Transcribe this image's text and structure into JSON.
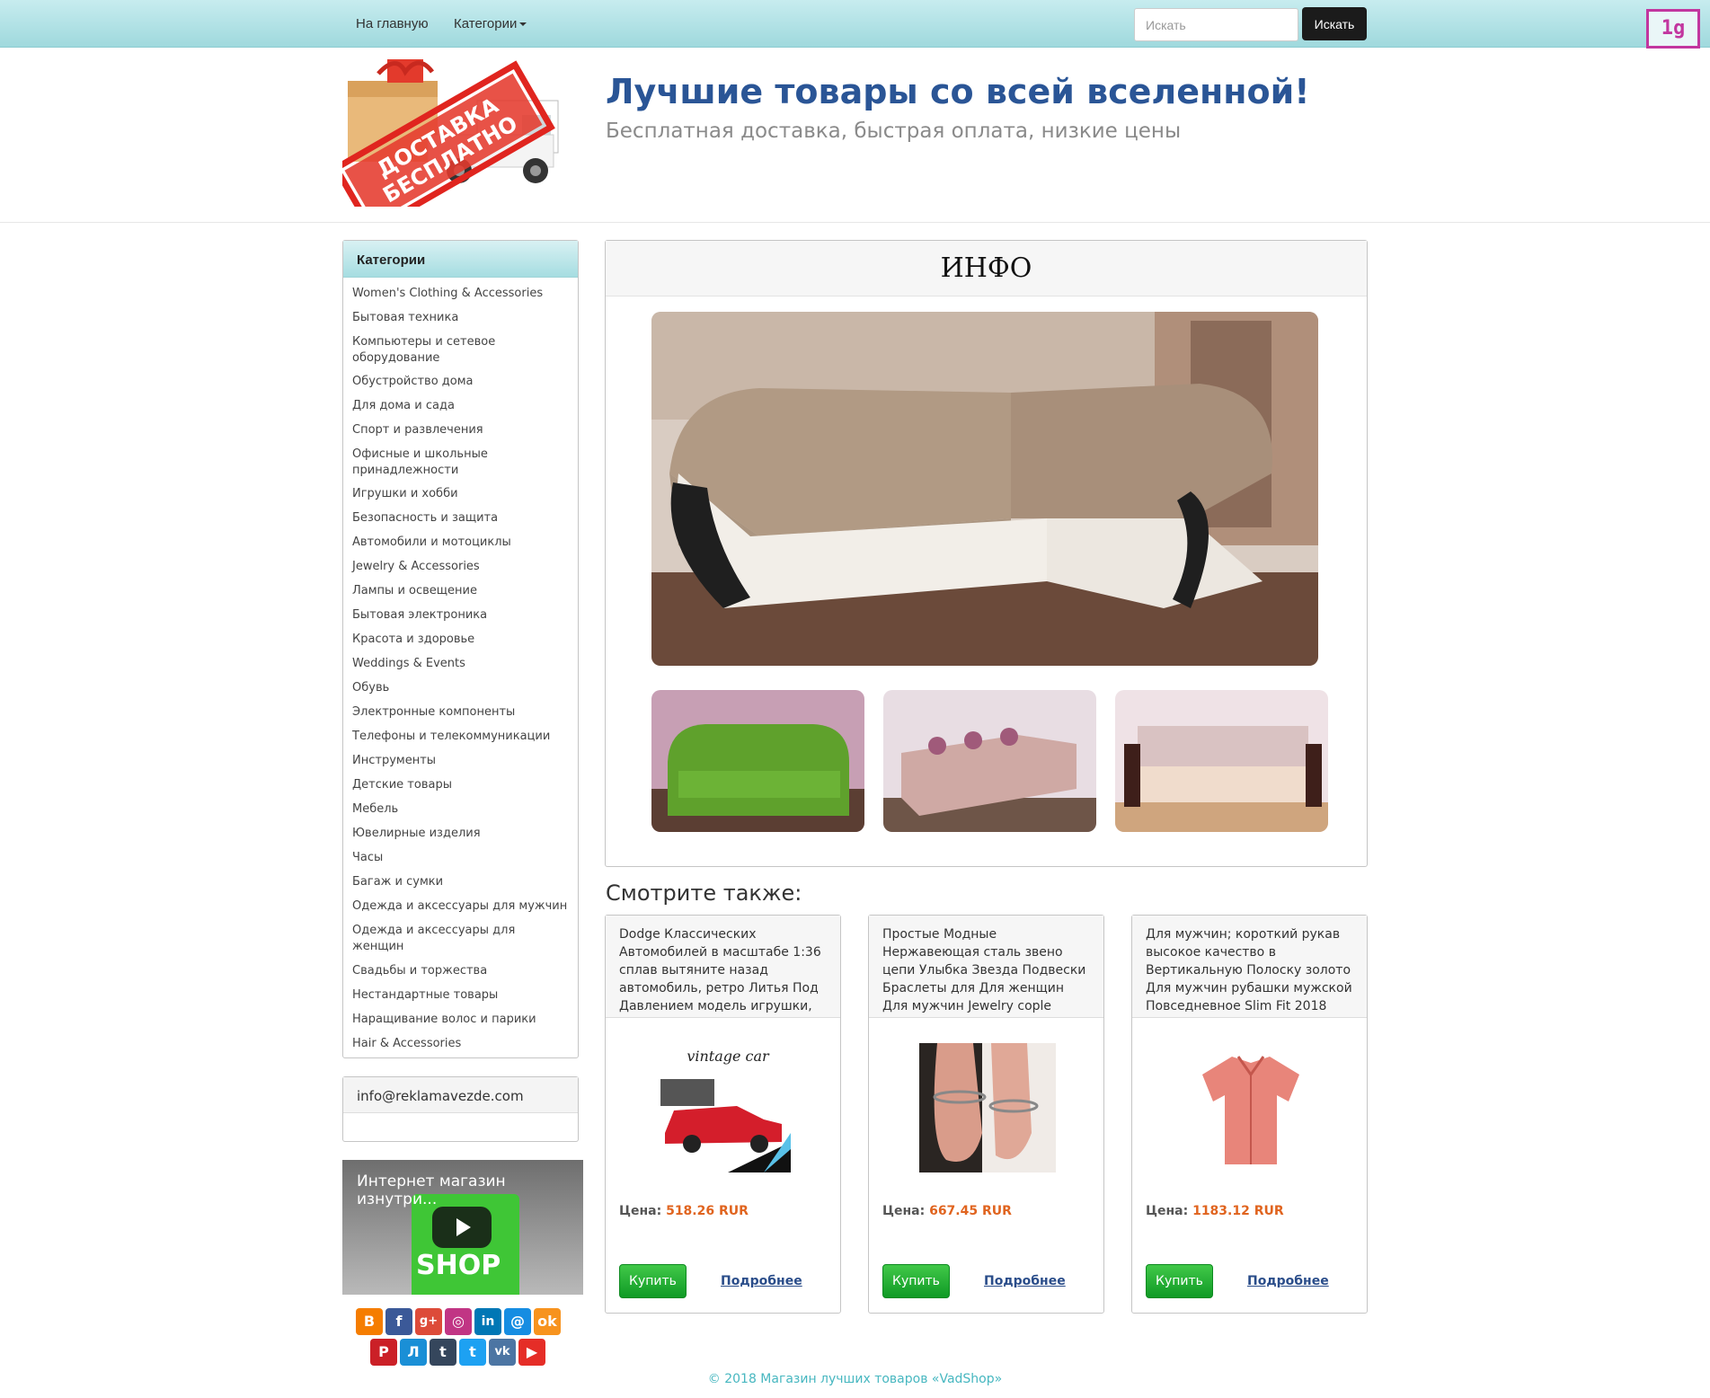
{
  "nav": {
    "home": "На главную",
    "categories": "Категории",
    "search_placeholder": "Искать",
    "search_button": "Искать",
    "badge": "1g"
  },
  "header": {
    "logo_line1": "ДОСТАВКА",
    "logo_line2": "БЕСПЛАТНО",
    "title": "Лучшие товары со всей вселенной!",
    "subtitle": "Бесплатная доставка, быстрая оплата, низкие цены"
  },
  "sidebar": {
    "categories_title": "Категории",
    "items": [
      "Women's Clothing & Accessories",
      "Бытовая техника",
      "Компьютеры и сетевое оборудование",
      "Обустройство дома",
      "Для дома и сада",
      "Спорт и развлечения",
      "Офисные и школьные принадлежности",
      "Игрушки и хобби",
      "Безопасность и защита",
      "Автомобили и мотоциклы",
      "Jewelry & Accessories",
      "Лампы и освещение",
      "Бытовая электроника",
      "Красота и здоровье",
      "Weddings & Events",
      "Обувь",
      "Электронные компоненты",
      "Телефоны и телекоммуникации",
      "Инструменты",
      "Детские товары",
      "Мебель",
      "Ювелирные изделия",
      "Часы",
      "Багаж и сумки",
      "Одежда и аксессуары для мужчин",
      "Одежда и аксессуары для женщин",
      "Свадьбы и торжества",
      "Нестандартные товары",
      "Наращивание волос и парики",
      "Hair & Accessories"
    ],
    "email": "info@reklamavezde.com",
    "video_title": "Интернет магазин изнутри...",
    "video_brand": "SHOP",
    "socials": [
      "blogger-icon",
      "facebook-icon",
      "googleplus-icon",
      "instagram-icon",
      "linkedin-icon",
      "moimir-icon",
      "odnoklassniki-icon",
      "pinterest-icon",
      "livejournal-icon",
      "tumblr-icon",
      "twitter-icon",
      "vk-icon",
      "youtube-icon"
    ]
  },
  "info": {
    "title": "ИНФО"
  },
  "see_also": {
    "title": "Смотрите также:",
    "price_label": "Цена:",
    "buy": "Купить",
    "more": "Подробнее",
    "products": [
      {
        "name": "Dodge Классических Автомобилей в масштабе 1:36 сплав вытяните назад автомобиль, ретро Литья Под Давлением модель игрушки,",
        "price": "518.26 RUR",
        "image_text": "vintage car"
      },
      {
        "name": "Простые Модные Нержавеющая сталь звено цепи Улыбка Звезда Подвески Браслеты для Для женщин Для мужчин Jewelry cople Браслеты Pulseira Masculina",
        "price": "667.45 RUR"
      },
      {
        "name": "Для мужчин; короткий рукав высокое качество в Вертикальную Полоску золото Для мужчин рубашки мужской Повседневное Slim Fit 2018",
        "price": "1183.12 RUR"
      }
    ]
  },
  "footer": {
    "text": "© 2018 Магазин лучших товаров «VadShop»"
  }
}
